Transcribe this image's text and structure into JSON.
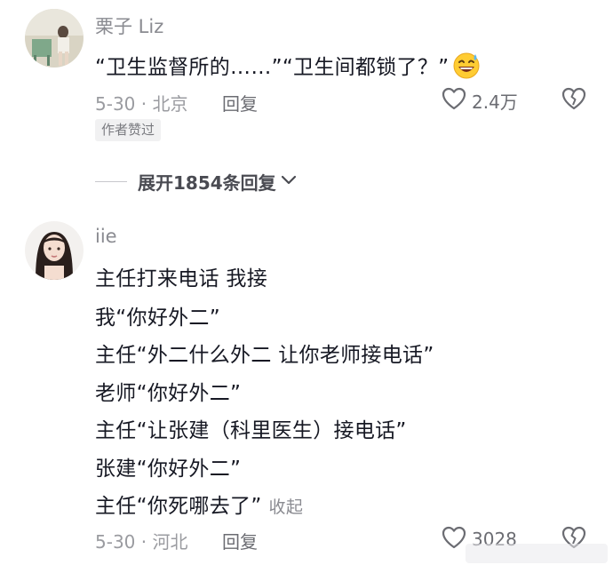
{
  "comments": [
    {
      "username": "栗子 Liz",
      "text_lines": [
        "“卫生监督所的……”“卫生间都锁了？”"
      ],
      "emoji": "grinning-sweat-emoji",
      "date_location": "5-30 · 北京",
      "reply_label": "回复",
      "like_count": "2.4万",
      "author_liked_tag": "作者赞过",
      "expand_replies_label": "展开1854条回复"
    },
    {
      "username": "iie",
      "text_lines": [
        "主任打来电话 我接",
        "我“你好外二”",
        "主任“外二什么外二 让你老师接电话”",
        "老师“你好外二”",
        "主任“让张建（科里医生）接电话”",
        "张建“你好外二”",
        "主任“你死哪去了”"
      ],
      "collapse_label": "收起",
      "date_location": "5-30 · 河北",
      "reply_label": "回复",
      "like_count": "3028"
    }
  ],
  "colors": {
    "primary_text": "#161823",
    "secondary_text": "#8a8b91",
    "tag_background": "#f1f1f2"
  },
  "icons": [
    "heart-outline-icon",
    "broken-heart-icon",
    "chevron-down-icon"
  ]
}
